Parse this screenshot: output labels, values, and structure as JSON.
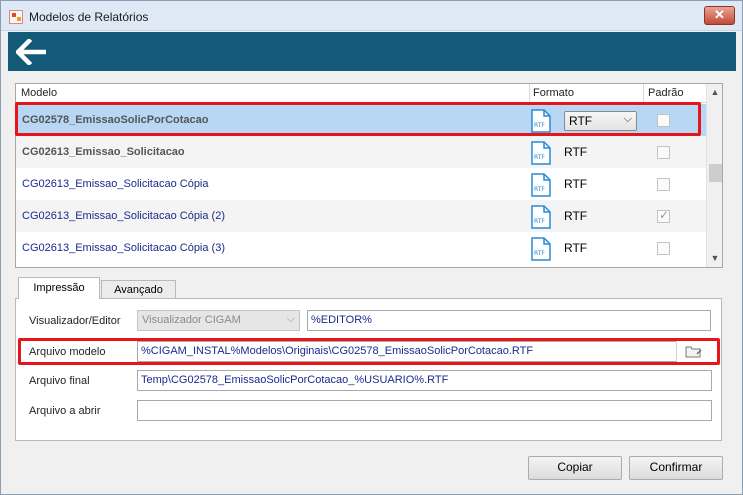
{
  "window": {
    "title": "Modelos de Relatórios",
    "close_glyph": "✕"
  },
  "header": {
    "back_icon": "arrow-left-icon"
  },
  "grid": {
    "columns": {
      "model": "Modelo",
      "format": "Formato",
      "default": "Padrão"
    },
    "rows": [
      {
        "name": "CG02578_EmissaoSolicPorCotacao",
        "format": "RTF",
        "default": false,
        "bold": true,
        "selected": true
      },
      {
        "name": "CG02613_Emissao_Solicitacao",
        "format": "RTF",
        "default": false,
        "bold": true,
        "selected": false
      },
      {
        "name": "CG02613_Emissao_Solicitacao Cópia",
        "format": "RTF",
        "default": false,
        "bold": false,
        "selected": false
      },
      {
        "name": "CG02613_Emissao_Solicitacao Cópia (2)",
        "format": "RTF",
        "default": true,
        "bold": false,
        "selected": false
      },
      {
        "name": "CG02613_Emissao_Solicitacao Cópia (3)",
        "format": "RTF",
        "default": false,
        "bold": false,
        "selected": false
      }
    ],
    "file_icon_label": "RTF"
  },
  "tabs": [
    {
      "label": "Impressão",
      "active": true
    },
    {
      "label": "Avançado",
      "active": false
    }
  ],
  "form": {
    "viewer": {
      "label": "Visualizador/Editor",
      "combo_value": "Visualizador CIGAM",
      "editor_value": "%EDITOR%"
    },
    "model_file": {
      "label": "Arquivo modelo",
      "value": "%CIGAM_INSTAL%Modelos\\Originais\\CG02578_EmissaoSolicPorCotacao.RTF"
    },
    "final_file": {
      "label": "Arquivo final",
      "value": "Temp\\CG02578_EmissaoSolicPorCotacao_%USUARIO%.RTF"
    },
    "open_file": {
      "label": "Arquivo a abrir",
      "value": ""
    }
  },
  "buttons": {
    "copy": "Copiar",
    "confirm": "Confirmar"
  },
  "colors": {
    "header_bar": "#135a78",
    "selected_row": "#b7d7f5",
    "highlight": "#e8141c",
    "link_text": "#1a2b8c"
  }
}
